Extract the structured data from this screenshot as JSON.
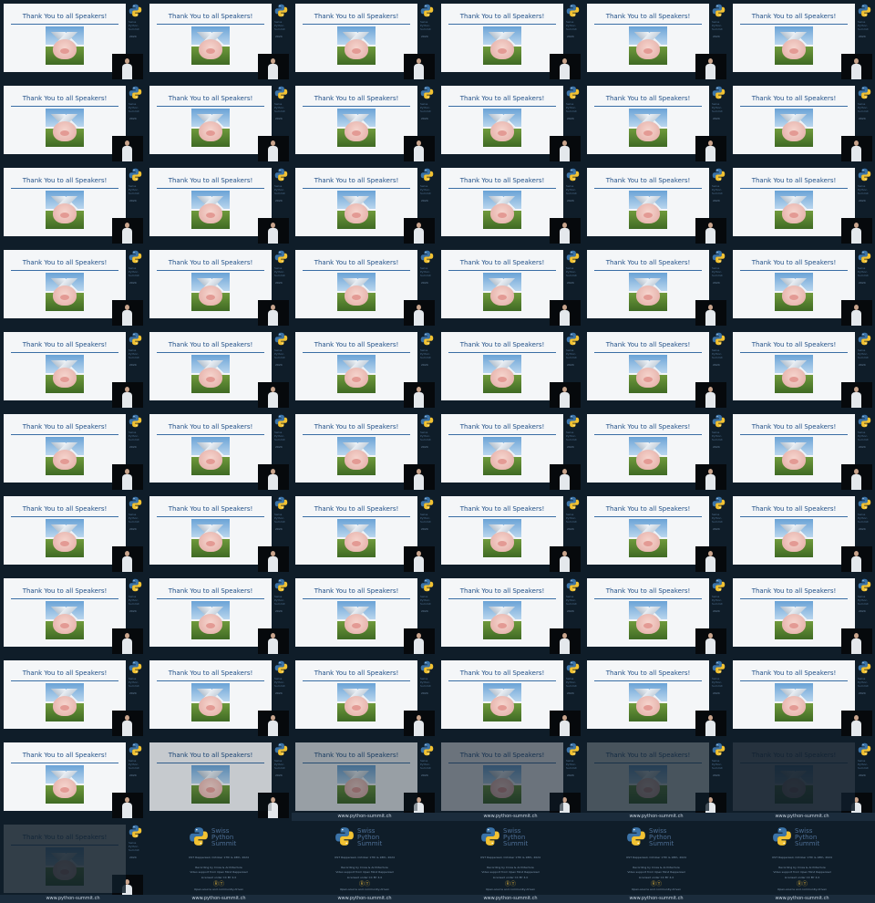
{
  "grid": {
    "columns": 6,
    "rows": 11
  },
  "slide": {
    "title": "Thank You to all Speakers!",
    "sidebar_lines": [
      "Swiss",
      "Python",
      "Summit"
    ],
    "sidebar_year": "2024"
  },
  "title_card": {
    "name_lines": [
      "Swiss",
      "Python",
      "Summit"
    ],
    "venue_line": "OST Rapperswil, October 17th & 18th, 2024",
    "sponsor_line_1": "Recording by Cross & Architecture",
    "sponsor_line_2": "Video support from Open Mind Rapperswil",
    "license_line": "Licensed under CC BY 4.0",
    "footnote": "Open-source and community-driven",
    "url": "www.python-summit.ch"
  },
  "last_row_fade": [
    0.0,
    0.2,
    0.4,
    0.6,
    0.75,
    0.9
  ],
  "colors": {
    "background": "#0d1a25",
    "slide": "#f4f6f8",
    "title": "#1f4e86",
    "python_blue": "#3b73a8",
    "python_yellow": "#f2c232"
  }
}
